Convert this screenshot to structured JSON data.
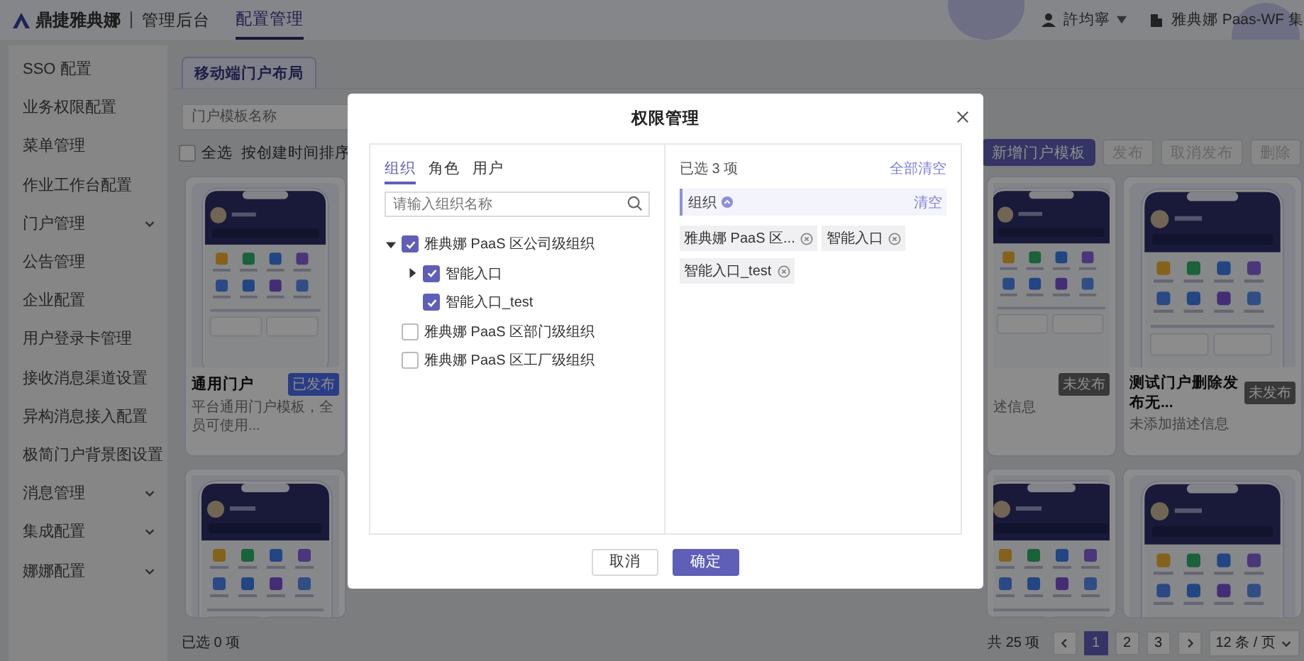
{
  "header": {
    "brand": "鼎捷雅典娜",
    "app_title": "管理后台",
    "nav": [
      {
        "label": "配置管理",
        "selected": true
      }
    ],
    "user": {
      "name": "許均寧"
    },
    "org": {
      "name": "雅典娜 Paas-WF 集"
    }
  },
  "sidebar": {
    "items": [
      {
        "label": "SSO 配置",
        "kind": "link"
      },
      {
        "label": "业务权限配置",
        "kind": "link"
      },
      {
        "label": "菜单管理",
        "kind": "link"
      },
      {
        "label": "作业工作台配置",
        "kind": "link"
      },
      {
        "label": "门户管理",
        "kind": "group",
        "expanded": false
      },
      {
        "label": "公告管理",
        "kind": "link"
      },
      {
        "label": "企业配置",
        "kind": "link"
      },
      {
        "label": "用户登录卡管理",
        "kind": "link"
      },
      {
        "label": "接收消息渠道设置",
        "kind": "link"
      },
      {
        "label": "异构消息接入配置",
        "kind": "link"
      },
      {
        "label": "极简门户背景图设置",
        "kind": "link"
      },
      {
        "label": "消息管理",
        "kind": "group",
        "expanded": false
      },
      {
        "label": "集成配置",
        "kind": "group",
        "expanded": false
      },
      {
        "label": "娜娜配置",
        "kind": "group",
        "expanded": false
      }
    ]
  },
  "main": {
    "tabs": [
      {
        "label": "移动端门户布局",
        "selected": true
      }
    ],
    "search": {
      "placeholder": "门户模板名称"
    },
    "select_all": {
      "label": "全选",
      "checked": false
    },
    "sort": {
      "label": "按创建时间排序"
    },
    "buttons": [
      {
        "label": "新增门户模板",
        "kind": "primary",
        "disabled": false
      },
      {
        "label": "发布",
        "kind": "default",
        "disabled": true
      },
      {
        "label": "取消发布",
        "kind": "default",
        "disabled": true
      },
      {
        "label": "删除",
        "kind": "default",
        "disabled": true
      }
    ],
    "cards": [
      {
        "title": "通用门户",
        "status": {
          "label": "已发布",
          "kind": "published"
        },
        "description": "平台通用门户模板，全员可使用..."
      },
      {
        "status": {
          "label": "未发布",
          "kind": "draft"
        },
        "description": "述信息"
      },
      {
        "title": "测试门户删除发布无...",
        "status": {
          "label": "未发布",
          "kind": "draft"
        },
        "description": "未添加描述信息"
      }
    ]
  },
  "footer": {
    "selected_count": "已选 0 项",
    "total": "共 25 项",
    "pages": [
      {
        "label": "1",
        "selected": true
      },
      {
        "label": "2",
        "selected": false
      },
      {
        "label": "3",
        "selected": false
      }
    ],
    "page_size": "12 条 / 页"
  },
  "dialog": {
    "title": "权限管理",
    "tabs": [
      {
        "label": "组织",
        "selected": true
      },
      {
        "label": "角色",
        "selected": false
      },
      {
        "label": "用户",
        "selected": false
      }
    ],
    "search": {
      "placeholder": "请输入组织名称"
    },
    "tree": [
      {
        "label": "雅典娜 PaaS 区公司级组织",
        "kind": "branch",
        "expanded": true,
        "checked": true,
        "children": [
          {
            "label": "智能入口",
            "kind": "branch",
            "expanded": false,
            "checked": true
          },
          {
            "label": "智能入口_test",
            "kind": "leaf",
            "checked": true
          }
        ]
      },
      {
        "label": "雅典娜 PaaS 区部门级组织",
        "kind": "leaf",
        "checked": false
      },
      {
        "label": "雅典娜 PaaS 区工厂级组织",
        "kind": "leaf",
        "checked": false
      }
    ],
    "selected_summary": "已选 3 项",
    "clear_all": "全部清空",
    "groups": [
      {
        "label": "组织",
        "expanded": true,
        "clear": "清空",
        "tags": [
          "雅典娜 PaaS 区...",
          "智能入口",
          "智能入口_test"
        ]
      }
    ],
    "buttons": [
      {
        "label": "取消",
        "kind": "default"
      },
      {
        "label": "确定",
        "kind": "primary"
      }
    ]
  }
}
